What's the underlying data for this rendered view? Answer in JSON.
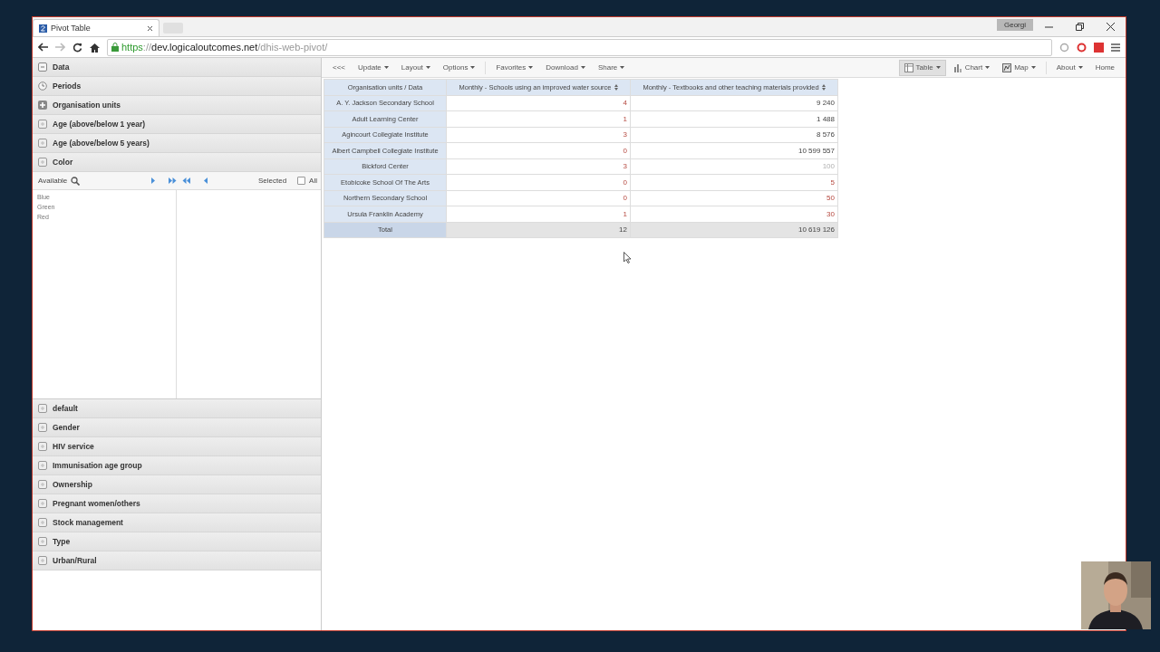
{
  "browser": {
    "tab_title": "Pivot Table",
    "profile": "Georgi",
    "url_scheme": "https",
    "url_host": "://dev.logicaloutcomes.net",
    "url_path": "/dhis-web-pivot/"
  },
  "sidebar": {
    "items": [
      {
        "label": "Data",
        "kind": "data",
        "expanded": false
      },
      {
        "label": "Periods",
        "kind": "period",
        "expanded": false
      },
      {
        "label": "Organisation units",
        "kind": "orgunit",
        "expanded": false
      },
      {
        "label": "Age (above/below 1 year)",
        "kind": "dimension",
        "expanded": false
      },
      {
        "label": "Age (above/below 5 years)",
        "kind": "dimension",
        "expanded": false
      },
      {
        "label": "Color",
        "kind": "dimension",
        "expanded": true,
        "available_label": "Available",
        "selected_label": "Selected",
        "all_label": "All",
        "all_checked": false,
        "available": [
          "Blue",
          "Green",
          "Red"
        ]
      },
      {
        "label": "default",
        "kind": "dimension",
        "expanded": false
      },
      {
        "label": "Gender",
        "kind": "dimension",
        "expanded": false
      },
      {
        "label": "HIV service",
        "kind": "dimension",
        "expanded": false
      },
      {
        "label": "Immunisation age group",
        "kind": "dimension",
        "expanded": false
      },
      {
        "label": "Ownership",
        "kind": "dimension",
        "expanded": false
      },
      {
        "label": "Pregnant women/others",
        "kind": "dimension",
        "expanded": false
      },
      {
        "label": "Stock management",
        "kind": "dimension",
        "expanded": false
      },
      {
        "label": "Type",
        "kind": "dimension",
        "expanded": false
      },
      {
        "label": "Urban/Rural",
        "kind": "dimension",
        "expanded": false
      }
    ]
  },
  "toolbar": {
    "collapse": "<<<",
    "left_groups": [
      [
        "Update",
        "Layout",
        "Options"
      ],
      [
        "Favorites",
        "Download",
        "Share"
      ]
    ],
    "views": [
      {
        "label": "Table",
        "kind": "table",
        "selected": true
      },
      {
        "label": "Chart",
        "kind": "chart",
        "selected": false
      },
      {
        "label": "Map",
        "kind": "map",
        "selected": false
      }
    ],
    "about": "About",
    "home": "Home"
  },
  "table": {
    "corner": "Organisation units / Data",
    "columns": [
      "Monthly - Schools using an improved water source",
      "Monthly - Textbooks and other teaching materials provided"
    ],
    "rows": [
      {
        "name": "A. Y. Jackson Secondary School",
        "cells": [
          {
            "value": "4",
            "kind": "flagged"
          },
          {
            "value": "9 240",
            "kind": "normal"
          }
        ]
      },
      {
        "name": "Adult Learning Center",
        "cells": [
          {
            "value": "1",
            "kind": "flagged"
          },
          {
            "value": "1 488",
            "kind": "normal"
          }
        ]
      },
      {
        "name": "Agincourt Collegiate Institute",
        "cells": [
          {
            "value": "3",
            "kind": "flagged"
          },
          {
            "value": "8 576",
            "kind": "normal"
          }
        ]
      },
      {
        "name": "Albert Campbell Collegiate Institute",
        "cells": [
          {
            "value": "0",
            "kind": "flagged"
          },
          {
            "value": "10 599 557",
            "kind": "normal"
          }
        ]
      },
      {
        "name": "Bickford Center",
        "cells": [
          {
            "value": "3",
            "kind": "flagged"
          },
          {
            "value": "100",
            "kind": "muted"
          }
        ]
      },
      {
        "name": "Etobicoke School Of The Arts",
        "cells": [
          {
            "value": "0",
            "kind": "flagged"
          },
          {
            "value": "5",
            "kind": "flagged"
          }
        ]
      },
      {
        "name": "Northern Secondary School",
        "cells": [
          {
            "value": "0",
            "kind": "flagged"
          },
          {
            "value": "50",
            "kind": "flagged"
          }
        ]
      },
      {
        "name": "Ursula Franklin Academy",
        "cells": [
          {
            "value": "1",
            "kind": "flagged"
          },
          {
            "value": "30",
            "kind": "flagged"
          }
        ]
      }
    ],
    "total": {
      "name": "Total",
      "cells": [
        "12",
        "10 619 126"
      ]
    }
  }
}
